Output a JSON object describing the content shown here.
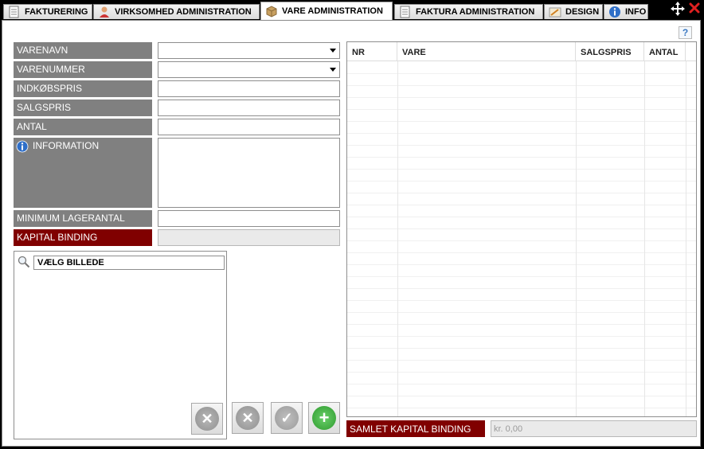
{
  "tabs": [
    {
      "label": "FAKTURERING",
      "icon": "document-icon"
    },
    {
      "label": "VIRKSOMHED ADMINISTRATION",
      "icon": "user-icon"
    },
    {
      "label": "VARE ADMINISTRATION",
      "icon": "box-icon",
      "active": true
    },
    {
      "label": "FAKTURA ADMINISTRATION",
      "icon": "document-icon"
    },
    {
      "label": "DESIGN",
      "icon": "design-icon"
    },
    {
      "label": "INFO",
      "icon": "info-icon"
    }
  ],
  "window_controls": {
    "move": "move-icon",
    "close": "close-icon"
  },
  "help": {
    "label": "?"
  },
  "form": {
    "varenavn": "VARENAVN",
    "varenummer": "VARENUMMER",
    "indkobspris": "INDKØBSPRIS",
    "salgspris": "SALGSPRIS",
    "antal": "ANTAL",
    "information": "INFORMATION",
    "minimum": "MINIMUM LAGERANTAL",
    "kapital": "KAPITAL BINDING"
  },
  "image": {
    "button_label": "VÆLG BILLEDE"
  },
  "table": {
    "columns": [
      "NR",
      "VARE",
      "SALGSPRIS",
      "ANTAL"
    ],
    "rows": []
  },
  "totals": {
    "label": "SAMLET KAPITAL BINDING",
    "value": "kr. 0,00"
  },
  "colors": {
    "label_gray": "#808080",
    "label_red": "#800000",
    "add_green": "#2e9a2e"
  }
}
